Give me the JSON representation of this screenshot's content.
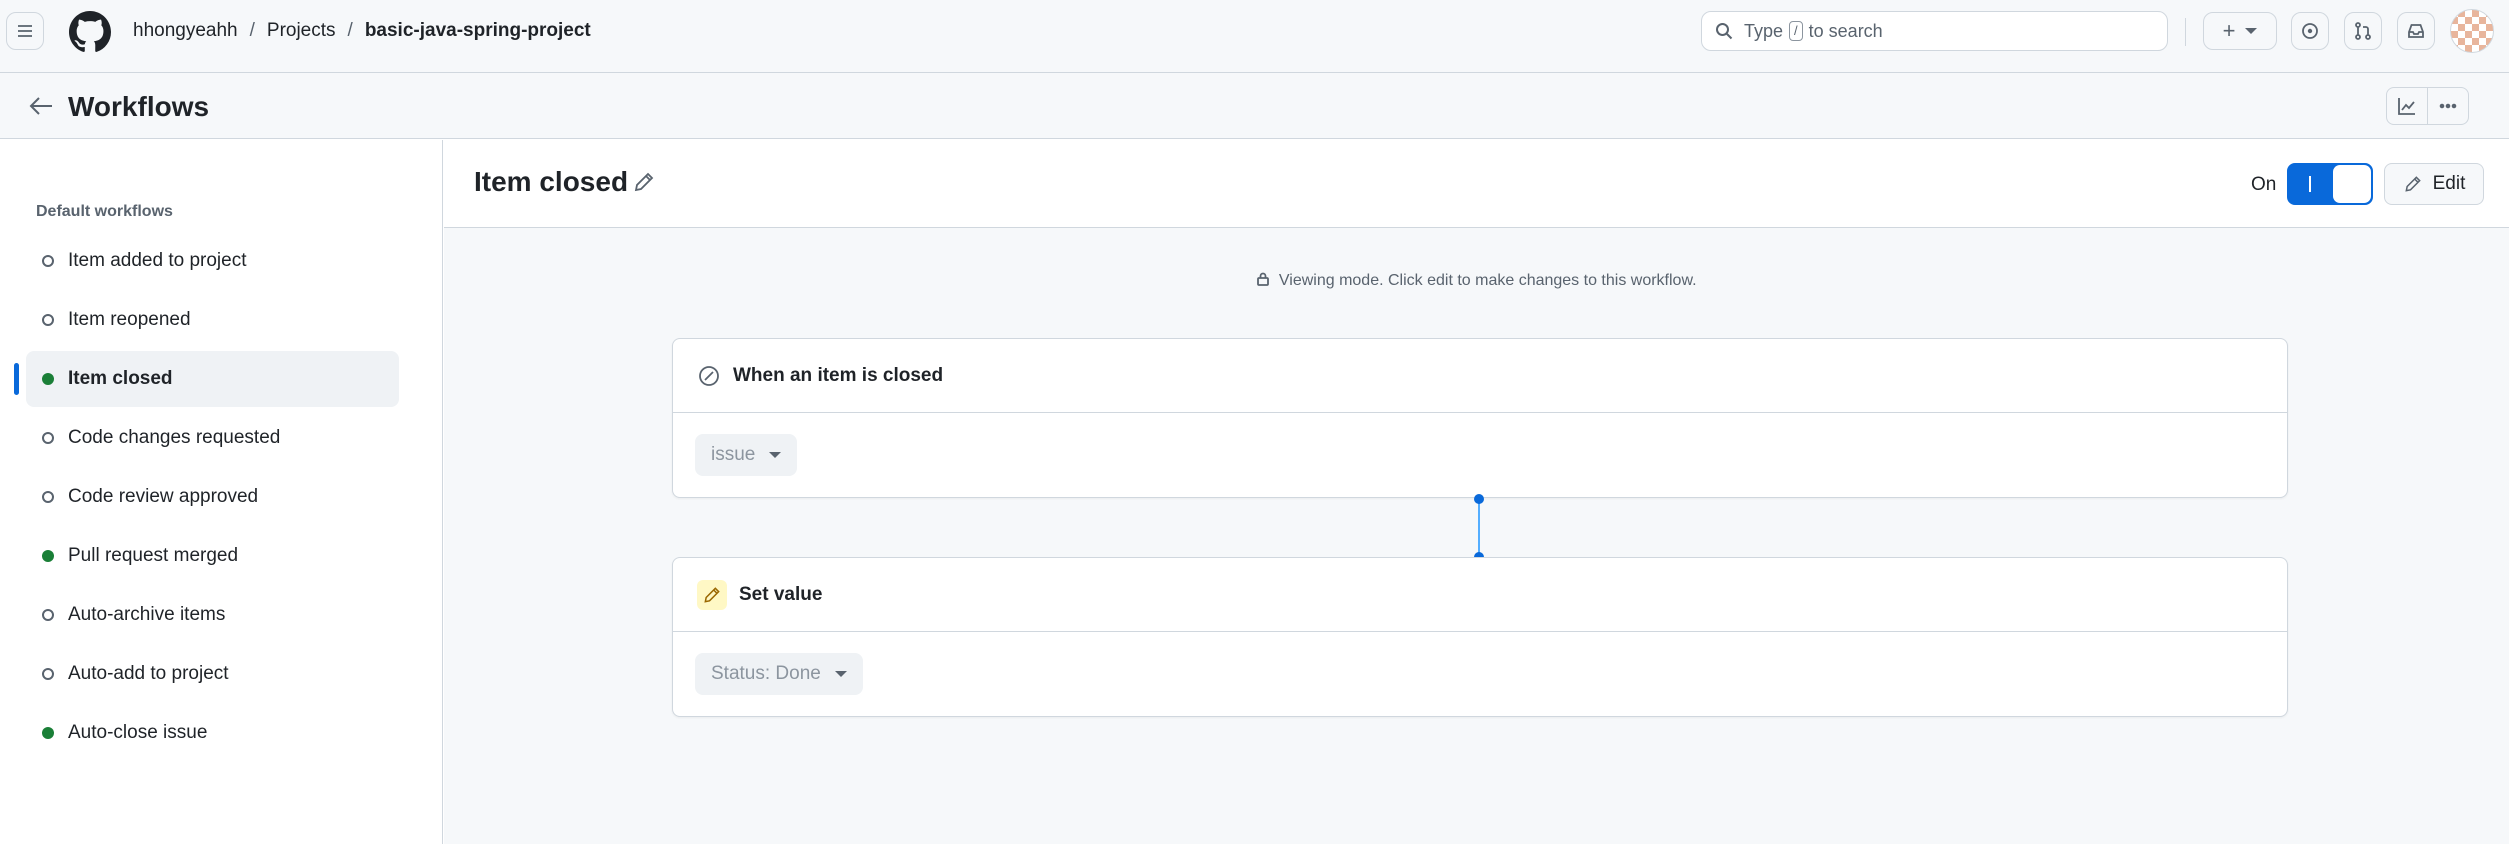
{
  "header": {
    "breadcrumb": {
      "user": "hhongyeahh",
      "sep1": "/",
      "projects": "Projects",
      "sep2": "/",
      "project": "basic-java-spring-project"
    },
    "search": {
      "prefix": "Type",
      "key": "/",
      "suffix": "to search"
    },
    "plus_label": "+"
  },
  "subheader": {
    "title": "Workflows"
  },
  "sidebar": {
    "heading": "Default workflows",
    "items": [
      {
        "label": "Item added to project",
        "enabled": false,
        "active": false
      },
      {
        "label": "Item reopened",
        "enabled": false,
        "active": false
      },
      {
        "label": "Item closed",
        "enabled": true,
        "active": true
      },
      {
        "label": "Code changes requested",
        "enabled": false,
        "active": false
      },
      {
        "label": "Code review approved",
        "enabled": false,
        "active": false
      },
      {
        "label": "Pull request merged",
        "enabled": true,
        "active": false
      },
      {
        "label": "Auto-archive items",
        "enabled": false,
        "active": false
      },
      {
        "label": "Auto-add to project",
        "enabled": false,
        "active": false
      },
      {
        "label": "Auto-close issue",
        "enabled": true,
        "active": false
      }
    ]
  },
  "workflow": {
    "title": "Item closed",
    "toggle_label": "On",
    "toggle_on": true,
    "edit_label": "Edit",
    "viewing_note": "Viewing mode. Click edit to make changes to this workflow.",
    "trigger": {
      "title": "When an item is closed",
      "select_value": "issue"
    },
    "action": {
      "title": "Set value",
      "select_value": "Status: Done"
    }
  },
  "colors": {
    "accent": "#0969da",
    "enabled_dot": "#1a7f37",
    "border": "#d0d7de"
  }
}
